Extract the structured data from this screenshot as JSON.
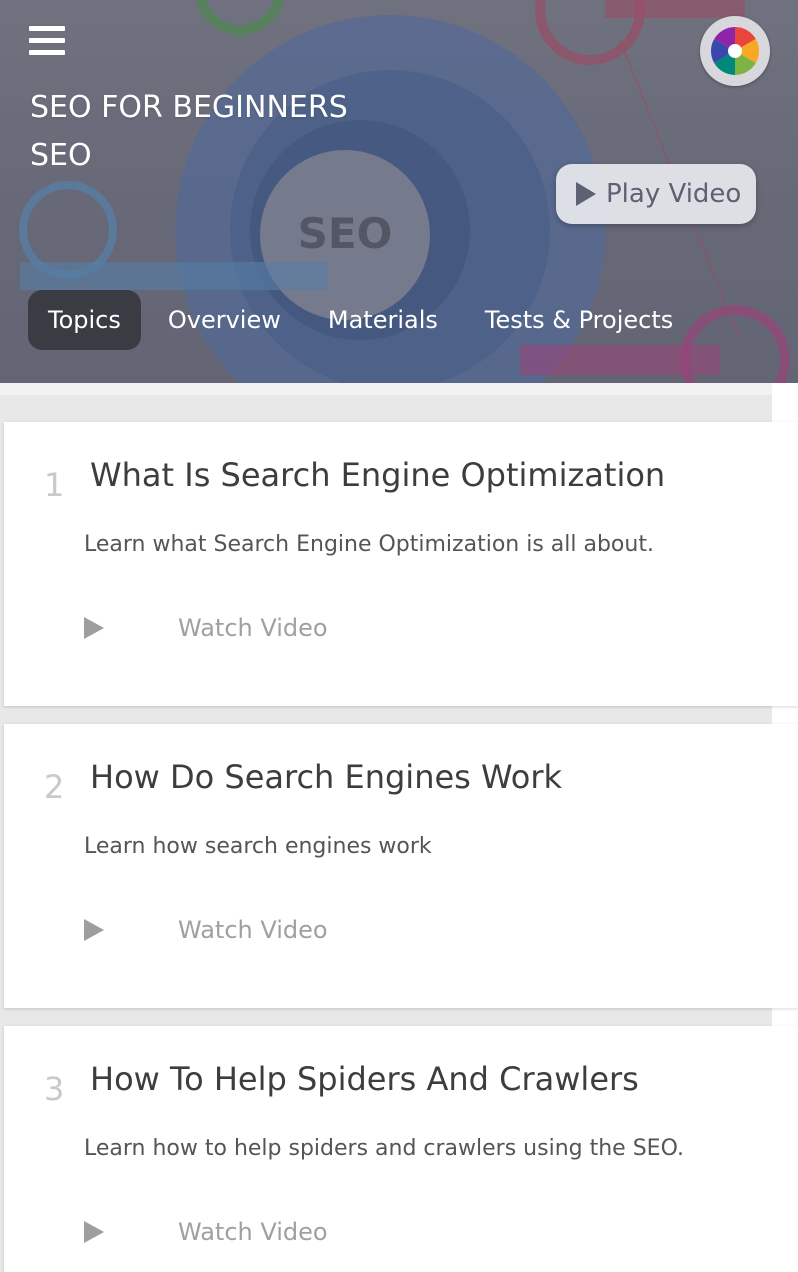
{
  "header": {
    "title": "SEO FOR BEGINNERS",
    "subtitle": "SEO",
    "play_video_label": "Play Video"
  },
  "tabs": [
    {
      "label": "Topics",
      "active": true
    },
    {
      "label": "Overview",
      "active": false
    },
    {
      "label": "Materials",
      "active": false
    },
    {
      "label": "Tests & Projects",
      "active": false
    }
  ],
  "topics": [
    {
      "number": "1",
      "title": "What Is Search Engine Optimization",
      "description": "Learn what Search Engine Optimization is all about.",
      "action": "Watch Video"
    },
    {
      "number": "2",
      "title": "How Do Search Engines Work",
      "description": "Learn how search engines work",
      "action": "Watch Video"
    },
    {
      "number": "3",
      "title": "How To Help Spiders And Crawlers",
      "description": "Learn how to help spiders and crawlers using the SEO.",
      "action": "Watch Video"
    }
  ],
  "colors": {
    "active_tab_bg": "#3a3b43",
    "card_title": "#3d3d3d",
    "muted": "#a0a0a0"
  },
  "icons": {
    "menu": "hamburger-menu-icon",
    "avatar": "app-logo-icon",
    "play": "play-icon"
  }
}
